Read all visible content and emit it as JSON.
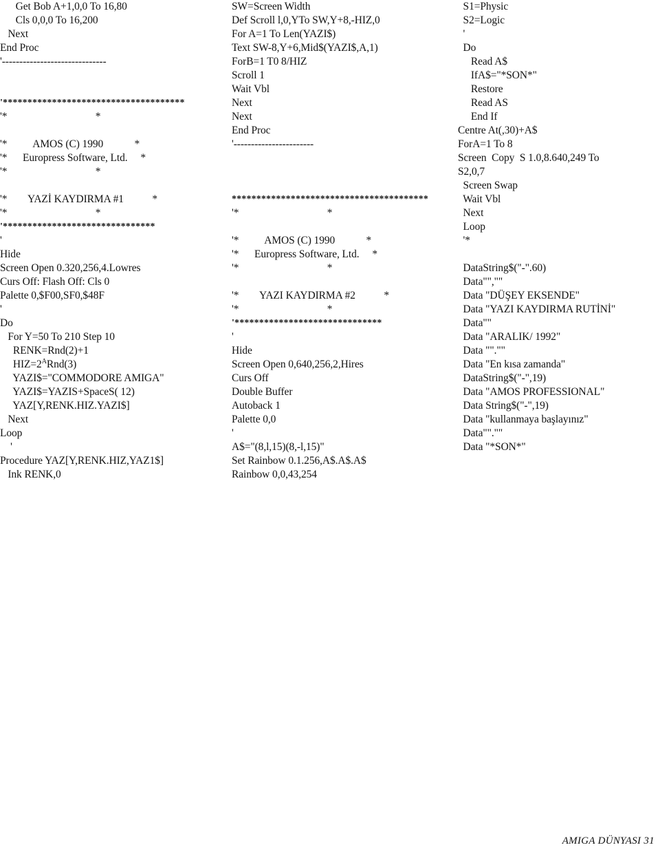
{
  "document": {
    "kind": "scanned-magazine-code-listing",
    "footer": "AMIGA DÜNYASI 31",
    "ink_color": "#131313",
    "paper_color": "#ffffff"
  },
  "columns": [
    {
      "id": "column-1",
      "lines": [
        "      Get Bob A+1,0,0 To 16,80",
        "      Cls 0,0,0 To 16,200",
        "   Next",
        "End Proc",
        "'------------------------------",
        "",
        "",
        "'*************************************",
        "'*                                  *",
        "",
        "'*          AMOS (C) 1990            *",
        "'*      Europress Software, Ltd.     *",
        "'*                                  *",
        "",
        "'*        YAZİ KAYDIRMA #1           *",
        "'*                                  *",
        "'*******************************",
        "'",
        "Hide",
        "Screen Open 0.320,256,4.Lowres",
        "Curs Off: Flash Off: Cls 0",
        "Palette 0,$F00,SF0,$48F",
        "'",
        "Do",
        "   For Y=50 To 210 Step 10",
        "     RENK=Rnd(2)+1",
        "     HIZ=2^Rnd(3)",
        "     YAZI$=\"COMMODORE AMIGA\"",
        "     YAZI$=YAZIS+SpaceS( 12)",
        "     YAZ[Y,RENK.HIZ.YAZI$]",
        "   Next",
        "Loop",
        "    '",
        "Procedure YAZ[Y,RENK.HIZ,YAZ1$]",
        "   Ink RENK,0"
      ]
    },
    {
      "id": "column-2",
      "lines": [
        "SW=Screen Width",
        "Def Scroll l,0,YTo SW,Y+8,-HIZ,0",
        "For A=1 To Len(YAZI$)",
        "Text SW-8,Y+6,Mid$(YAZI$,A,1)",
        "ForB=1 T0 8/HIZ",
        "Scroll 1",
        "Wait Vbl",
        "Next",
        "Next",
        "End Proc",
        "'-----------------------",
        "",
        "",
        "",
        "****************************************",
        "'*                                  *",
        "",
        "'*          AMOS (C) 1990            *",
        "'*      Europress Software, Ltd.     *",
        "'*                                  *",
        "",
        "'*        YAZI KAYDIRMA #2           *",
        "'*                                  *",
        "'******************************",
        "'",
        "Hide",
        "Screen Open 0,640,256,2,Hires",
        "Curs Off",
        "Double Buffer",
        "Autoback 1",
        "Palette 0,0",
        "'",
        "A$=\"(8,l,15)(8,-l,15)\"",
        "Set Rainbow 0.1.256,A$.A$.A$",
        "Rainbow 0,0,43,254"
      ]
    },
    {
      "id": "column-3",
      "lines": [
        "  S1=Physic",
        "  S2=Logic",
        "  '",
        "  Do",
        "     Read A$",
        "     IfA$=\"*SON*\"",
        "     Restore",
        "     Read AS",
        "     End If",
        "Centre At(,30)+A$",
        "ForA=1 To 8",
        "Screen  Copy  S 1.0,8.640,249 To",
        "S2,0,7",
        "  Screen Swap",
        "  Wait Vbl",
        "  Next",
        "  Loop",
        "  '*",
        "",
        "  DataString$(\"-\".60)",
        "  Data\"\",\"\"",
        "  Data \"DÜŞEY EKSENDE\"",
        "  Data \"YAZI KAYDIRMA RUTİNİ\"",
        "  Data\"\"",
        "  Data \"ARALIK/ 1992\"",
        "  Data \"\".\"\"",
        "  Data \"En kısa zamanda\"",
        "  DataString$(\"-\",19)",
        "  Data \"AMOS PROFESSIONAL\"",
        "  Data String$(\"-\",19)",
        "  Data \"kullanmaya başlayınız\"",
        "  Data\"\".\"\"",
        "  Data \"*SON*\""
      ]
    }
  ]
}
